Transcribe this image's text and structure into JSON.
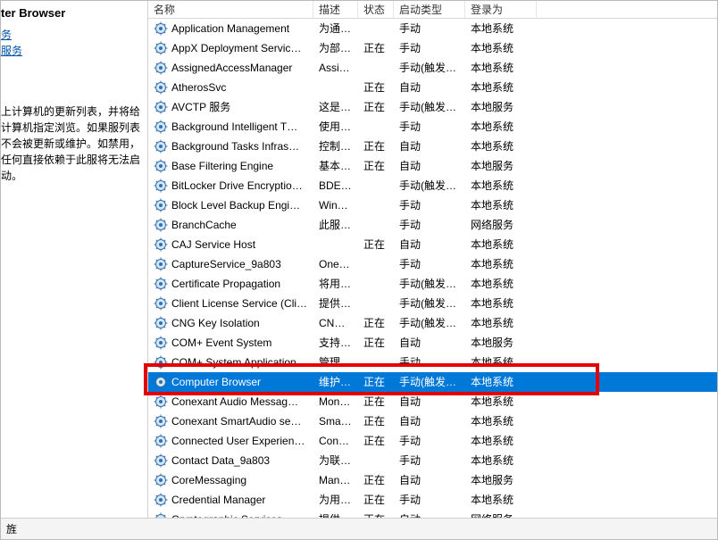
{
  "left": {
    "title": "ter Browser",
    "links": [
      "务",
      "服务"
    ],
    "desc": "上计算机的更新列表，并将给计算机指定浏览。如果服列表不会被更新或维护。如禁用，任何直接依赖于此服将无法启动。"
  },
  "columns": {
    "name": "名称",
    "desc": "描述",
    "state": "状态",
    "start": "启动类型",
    "logon": "登录为"
  },
  "services": [
    {
      "name": "Application Management",
      "desc": "为通…",
      "state": "",
      "start": "手动",
      "logon": "本地系统"
    },
    {
      "name": "AppX Deployment Servic…",
      "desc": "为部…",
      "state": "正在",
      "start": "手动",
      "logon": "本地系统"
    },
    {
      "name": "AssignedAccessManager",
      "desc": "Assi…",
      "state": "",
      "start": "手动(触发…",
      "logon": "本地系统"
    },
    {
      "name": "AtherosSvc",
      "desc": "",
      "state": "正在",
      "start": "自动",
      "logon": "本地系统"
    },
    {
      "name": "AVCTP 服务",
      "desc": "这是…",
      "state": "正在",
      "start": "手动(触发…",
      "logon": "本地服务"
    },
    {
      "name": "Background Intelligent T…",
      "desc": "使用…",
      "state": "",
      "start": "手动",
      "logon": "本地系统"
    },
    {
      "name": "Background Tasks Infras…",
      "desc": "控制…",
      "state": "正在",
      "start": "自动",
      "logon": "本地系统"
    },
    {
      "name": "Base Filtering Engine",
      "desc": "基本…",
      "state": "正在",
      "start": "自动",
      "logon": "本地服务"
    },
    {
      "name": "BitLocker Drive Encryptio…",
      "desc": "BDE…",
      "state": "",
      "start": "手动(触发…",
      "logon": "本地系统"
    },
    {
      "name": "Block Level Backup Engi…",
      "desc": "Win…",
      "state": "",
      "start": "手动",
      "logon": "本地系统"
    },
    {
      "name": "BranchCache",
      "desc": "此服…",
      "state": "",
      "start": "手动",
      "logon": "网络服务"
    },
    {
      "name": "CAJ Service Host",
      "desc": "",
      "state": "正在",
      "start": "自动",
      "logon": "本地系统"
    },
    {
      "name": "CaptureService_9a803",
      "desc": "One…",
      "state": "",
      "start": "手动",
      "logon": "本地系统"
    },
    {
      "name": "Certificate Propagation",
      "desc": "将用…",
      "state": "",
      "start": "手动(触发…",
      "logon": "本地系统"
    },
    {
      "name": "Client License Service (Cli…",
      "desc": "提供…",
      "state": "",
      "start": "手动(触发…",
      "logon": "本地系统"
    },
    {
      "name": "CNG Key Isolation",
      "desc": "CNG…",
      "state": "正在",
      "start": "手动(触发…",
      "logon": "本地系统"
    },
    {
      "name": "COM+ Event System",
      "desc": "支持…",
      "state": "正在",
      "start": "自动",
      "logon": "本地服务"
    },
    {
      "name": "COM+ System Application",
      "desc": "管理…",
      "state": "",
      "start": "手动",
      "logon": "本地系统"
    },
    {
      "name": "Computer Browser",
      "desc": "维护…",
      "state": "正在",
      "start": "手动(触发…",
      "logon": "本地系统",
      "selected": true
    },
    {
      "name": "Conexant Audio Messag…",
      "desc": "Mon…",
      "state": "正在",
      "start": "自动",
      "logon": "本地系统"
    },
    {
      "name": "Conexant SmartAudio se…",
      "desc": "Sma…",
      "state": "正在",
      "start": "自动",
      "logon": "本地系统"
    },
    {
      "name": "Connected User Experien…",
      "desc": "Con…",
      "state": "正在",
      "start": "手动",
      "logon": "本地系统"
    },
    {
      "name": "Contact Data_9a803",
      "desc": "为联…",
      "state": "",
      "start": "手动",
      "logon": "本地系统"
    },
    {
      "name": "CoreMessaging",
      "desc": "Man…",
      "state": "正在",
      "start": "自动",
      "logon": "本地服务"
    },
    {
      "name": "Credential Manager",
      "desc": "为用…",
      "state": "正在",
      "start": "手动",
      "logon": "本地系统"
    },
    {
      "name": "Cryptographic Services",
      "desc": "提供…",
      "state": "正在",
      "start": "自动",
      "logon": "网络服务"
    }
  ],
  "status": "旌"
}
